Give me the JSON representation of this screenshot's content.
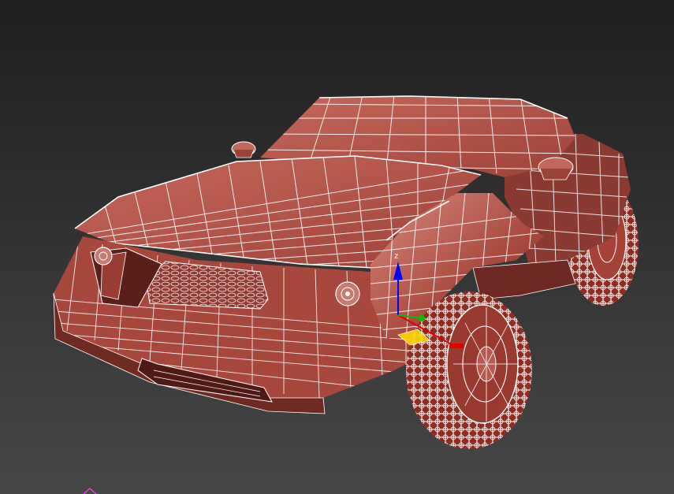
{
  "viewport": {
    "background_top": "#1f1f1f",
    "background_bottom": "#474747",
    "label": ""
  },
  "model": {
    "name": "car",
    "body_color": "#b9574d",
    "body_dark_color": "#7f3329",
    "body_light_color": "#cf7a6d",
    "wire_color": "#ffffff",
    "tire_color": "#8e2e22",
    "mesh_color": "#d9a8a0"
  },
  "gizmo": {
    "x_axis_color": "#e00000",
    "y_axis_color": "#00c000",
    "z_axis_color": "#0000ff",
    "plane_color": "#ffd800",
    "z_label": "z"
  }
}
